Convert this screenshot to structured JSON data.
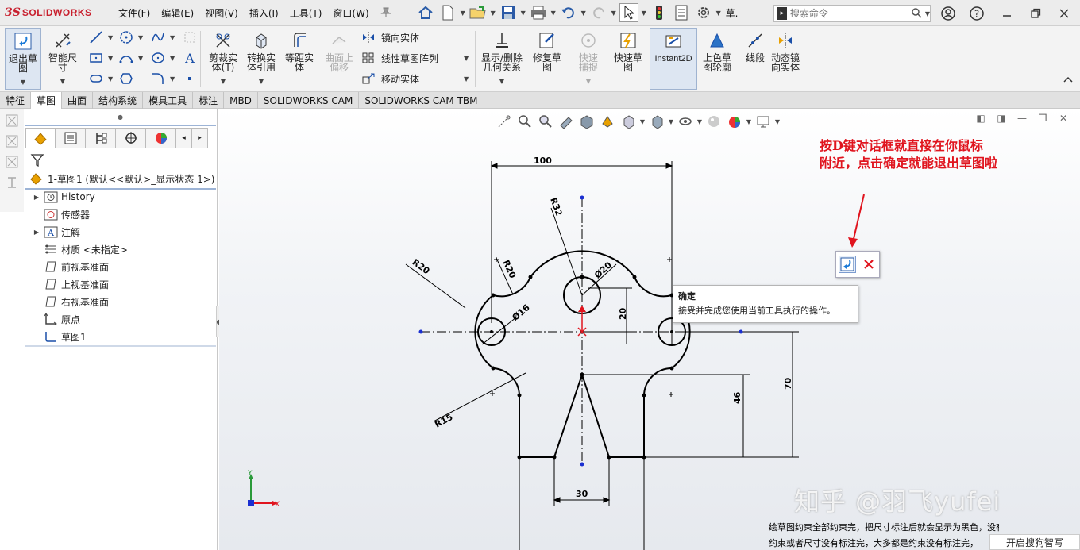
{
  "app": {
    "brand_prefix": "3S",
    "brand_name": "SOLIDWORKS"
  },
  "menu": [
    "文件(F)",
    "编辑(E)",
    "视图(V)",
    "插入(I)",
    "工具(T)",
    "窗口(W)"
  ],
  "quick_toolbar": {
    "truncated_label": "草."
  },
  "search": {
    "placeholder": "搜索命令"
  },
  "ribbon": {
    "exit_sketch": "退出草图",
    "smart_dim": "智能尺寸",
    "trim": "剪裁实体(T)",
    "convert": "转换实体引用",
    "offset": "等距实体",
    "surface_offset": "曲面上偏移",
    "mirror": "镜向实体",
    "linear_pattern": "线性草图阵列",
    "move": "移动实体",
    "show_delete": "显示/删除几何关系",
    "repair": "修复草图",
    "quick_snap": "快速捕捉",
    "rapid_sketch": "快速草图",
    "instant2d": "Instant2D",
    "shaded_contour": "上色草图轮廓",
    "segment": "线段",
    "dynamic_mirror": "动态镜向实体"
  },
  "tabs": [
    {
      "label": "特征",
      "active": false
    },
    {
      "label": "草图",
      "active": true
    },
    {
      "label": "曲面",
      "active": false
    },
    {
      "label": "结构系统",
      "active": false
    },
    {
      "label": "模具工具",
      "active": false
    },
    {
      "label": "标注",
      "active": false
    },
    {
      "label": "MBD",
      "active": false
    },
    {
      "label": "SOLIDWORKS CAM",
      "active": false
    },
    {
      "label": "SOLIDWORKS CAM TBM",
      "active": false
    }
  ],
  "tree": {
    "root": "1-草图1  (默认<<默认>_显示状态 1>)",
    "items": [
      {
        "label": "History",
        "expandable": true
      },
      {
        "label": "传感器",
        "expandable": false
      },
      {
        "label": "注解",
        "expandable": true
      },
      {
        "label": "材质 <未指定>",
        "expandable": false
      },
      {
        "label": "前视基准面",
        "expandable": false
      },
      {
        "label": "上视基准面",
        "expandable": false
      },
      {
        "label": "右视基准面",
        "expandable": false
      },
      {
        "label": "原点",
        "expandable": false
      },
      {
        "label": "草图1",
        "expandable": false
      }
    ]
  },
  "annotation": {
    "line1": "按D键对话框就直接在你鼠标",
    "line2": "附近，点击确定就能退出草图啦"
  },
  "tooltip": {
    "title": "确定",
    "body": "接受并完成您使用当前工具执行的操作。"
  },
  "dimensions": {
    "d100": "100",
    "r32": "R32",
    "r20a": "R20",
    "r20b": "R20",
    "dia20": "Ø20",
    "dia16": "Ø16",
    "d20": "20",
    "r15": "R15",
    "d46": "46",
    "d70": "70",
    "d30": "30"
  },
  "triad": {
    "y": "Y",
    "x": "X"
  },
  "watermark": "知乎 @羽飞yufei",
  "bottom_note": {
    "line1": "绘草图约束全部约束完，把尺寸标注后就会显示为黑色，没有就是",
    "line2": "约束或者尺寸没有标注完，大多都是约束没有标注完，"
  },
  "status_button": "开启搜狗智写",
  "colors": {
    "accent_red": "#e0141e",
    "brand_red": "#c8202e",
    "sketch_blue": "#1a2fd1"
  }
}
